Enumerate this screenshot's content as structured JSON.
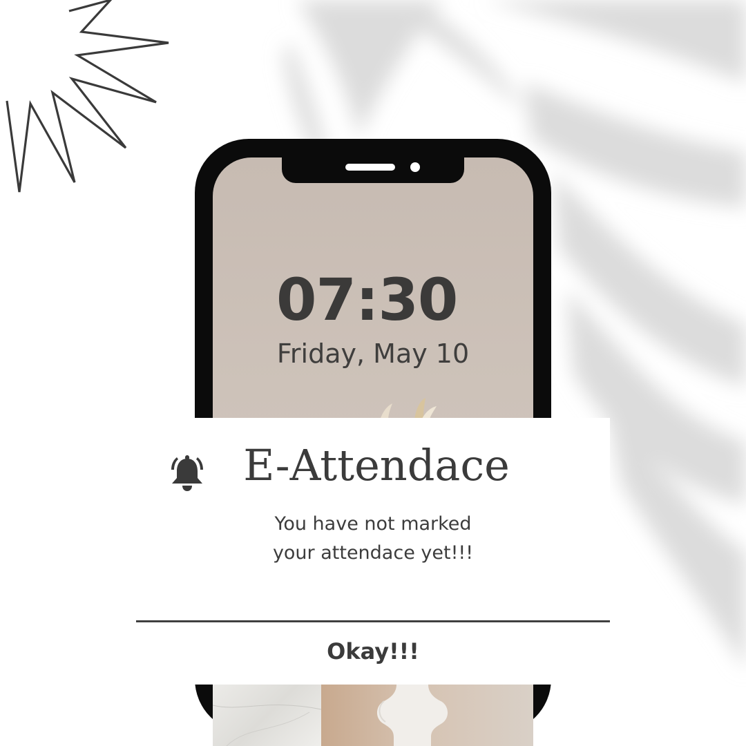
{
  "lockscreen": {
    "time": "07:30",
    "date": "Friday, May 10"
  },
  "notification": {
    "icon": "bell-ring-icon",
    "title": "E-Attendace",
    "message_line1": "You have not marked",
    "message_line2": "your attendace yet!!!",
    "action_label": "Okay!!!"
  },
  "colors": {
    "text": "#3b3b3b",
    "phone_frame": "#0b0b0b",
    "screen_wallpaper": "#c9bdb4",
    "card_background": "#ffffff"
  }
}
